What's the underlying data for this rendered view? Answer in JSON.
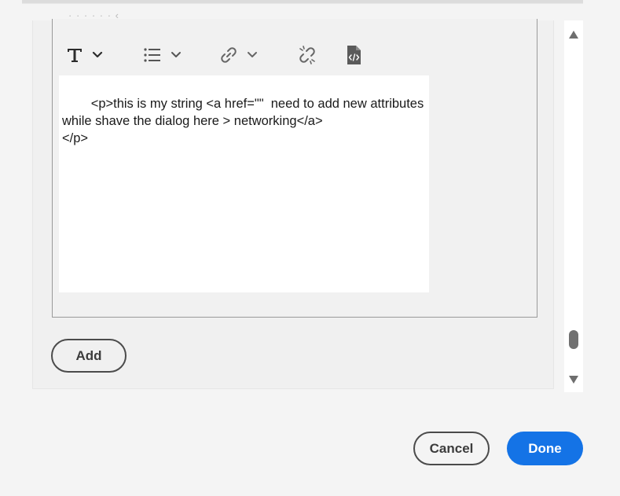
{
  "editor": {
    "toolbar": [
      {
        "name": "text-style",
        "icon": "text-format-icon",
        "has_dropdown": true
      },
      {
        "name": "list",
        "icon": "bulleted-list-icon",
        "has_dropdown": true
      },
      {
        "name": "link",
        "icon": "link-icon",
        "has_dropdown": true
      },
      {
        "name": "unlink",
        "icon": "unlink-icon",
        "has_dropdown": false
      },
      {
        "name": "source",
        "icon": "source-code-icon",
        "has_dropdown": false
      }
    ],
    "content": "<p>this is my string <a href=\"\"  need to add new attributes\nwhile shave the dialog here > networking</a>\n</p>"
  },
  "buttons": {
    "add_label": "Add",
    "cancel_label": "Cancel",
    "done_label": "Done"
  },
  "colors": {
    "accent": "#1473e6",
    "outline": "#4b4b4b",
    "panel": "#f0f0f0"
  }
}
